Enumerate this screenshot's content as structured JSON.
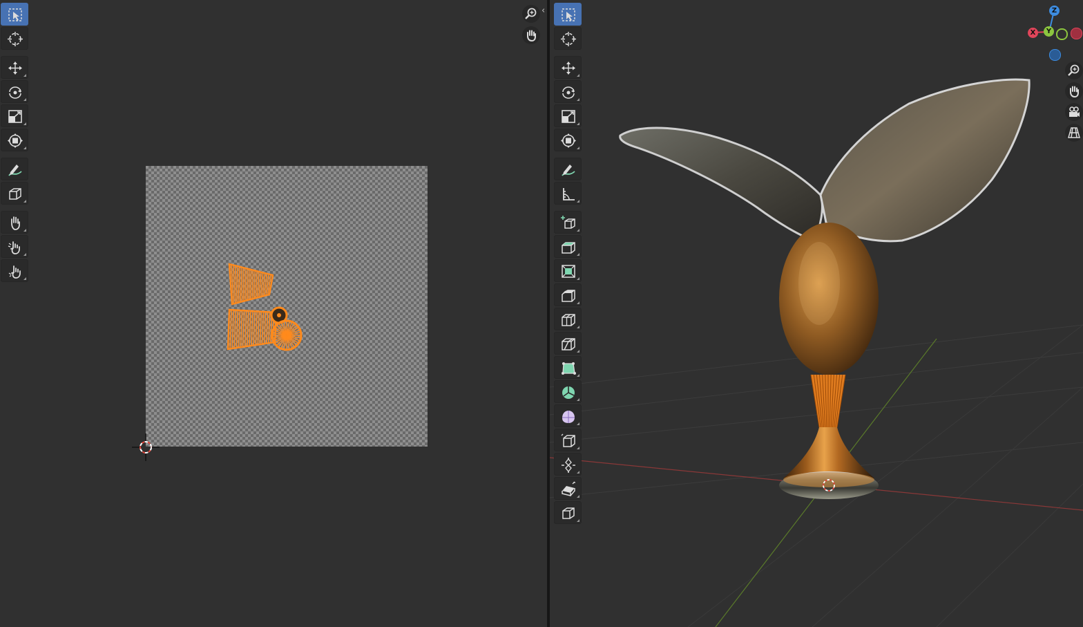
{
  "uv_editor": {
    "tools": [
      {
        "name": "select-box-tool",
        "icon": "select-box-icon",
        "active": true
      },
      {
        "name": "cursor-tool",
        "icon": "cursor-icon",
        "active": false
      },
      {
        "name": "move-tool",
        "icon": "move-icon",
        "active": false
      },
      {
        "name": "rotate-tool",
        "icon": "rotate-icon",
        "active": false
      },
      {
        "name": "scale-tool",
        "icon": "scale-icon",
        "active": false
      },
      {
        "name": "transform-tool",
        "icon": "transform-icon",
        "active": false
      },
      {
        "name": "annotate-tool",
        "icon": "annotate-icon",
        "active": false
      },
      {
        "name": "rip-region-tool",
        "icon": "rip-region-icon",
        "active": false
      },
      {
        "name": "grab-tool",
        "icon": "grab-hand-icon",
        "active": false
      },
      {
        "name": "relax-tool",
        "icon": "relax-hand-icon",
        "active": false
      },
      {
        "name": "pinch-tool",
        "icon": "pinch-hand-icon",
        "active": false
      }
    ],
    "nav": [
      "zoom-icon",
      "pan-hand-icon"
    ],
    "collapse_arrow": "‹"
  },
  "viewport": {
    "tools": [
      {
        "name": "select-box-tool",
        "icon": "select-box-icon",
        "active": true
      },
      {
        "name": "cursor-tool",
        "icon": "cursor-icon",
        "active": false
      },
      {
        "name": "move-tool",
        "icon": "move-icon",
        "active": false
      },
      {
        "name": "rotate-tool",
        "icon": "rotate-icon",
        "active": false
      },
      {
        "name": "scale-tool",
        "icon": "scale-icon",
        "active": false
      },
      {
        "name": "transform-tool",
        "icon": "transform-icon",
        "active": false
      },
      {
        "name": "annotate-tool",
        "icon": "annotate-icon",
        "active": false
      },
      {
        "name": "measure-tool",
        "icon": "measure-icon",
        "active": false
      },
      {
        "name": "add-cube-tool",
        "icon": "add-cube-icon",
        "active": false
      },
      {
        "name": "extrude-tool",
        "icon": "extrude-icon",
        "active": false
      },
      {
        "name": "inset-faces-tool",
        "icon": "inset-icon",
        "active": false
      },
      {
        "name": "bevel-tool",
        "icon": "bevel-icon",
        "active": false
      },
      {
        "name": "loop-cut-tool",
        "icon": "loop-cut-icon",
        "active": false
      },
      {
        "name": "knife-tool",
        "icon": "knife-icon",
        "active": false
      },
      {
        "name": "poly-build-tool",
        "icon": "poly-build-icon",
        "active": false
      },
      {
        "name": "spin-tool",
        "icon": "spin-icon",
        "active": false
      },
      {
        "name": "smooth-tool",
        "icon": "smooth-icon",
        "active": false
      },
      {
        "name": "edge-slide-tool",
        "icon": "edge-slide-icon",
        "active": false
      },
      {
        "name": "shrink-fatten-tool",
        "icon": "shrink-fatten-icon",
        "active": false
      },
      {
        "name": "shear-tool",
        "icon": "shear-icon",
        "active": false
      },
      {
        "name": "rip-region-tool",
        "icon": "rip-region-icon",
        "active": false
      }
    ],
    "gizmo": {
      "x": "X",
      "y": "Y",
      "z": "Z"
    },
    "nav": [
      "zoom-icon",
      "pan-hand-icon",
      "camera-icon",
      "ortho-grid-icon"
    ]
  },
  "colors": {
    "background": "#303030",
    "active_tool": "#4772b3",
    "uv_selection": "#ff8a1c",
    "axis_x": "#e0455a",
    "axis_y": "#8cc63f",
    "axis_z": "#3d8ce0"
  }
}
